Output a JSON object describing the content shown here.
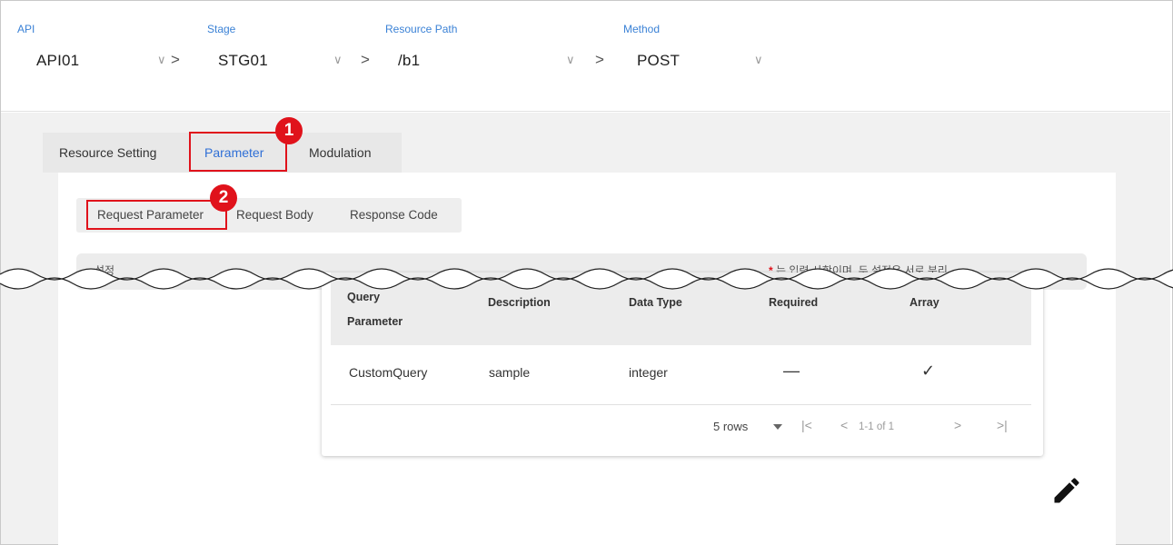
{
  "breadcrumb": {
    "api": {
      "label": "API",
      "value": "API01"
    },
    "stage": {
      "label": "Stage",
      "value": "STG01"
    },
    "resource_path": {
      "label": "Resource Path",
      "value": "/b1"
    },
    "method": {
      "label": "Method",
      "value": "POST"
    },
    "separator": ">",
    "chevron": "∨"
  },
  "tabs": [
    {
      "label": "Resource Setting"
    },
    {
      "label": "Parameter",
      "active": true
    },
    {
      "label": "Modulation"
    }
  ],
  "subtabs": [
    {
      "label": "Request Parameter",
      "active": true
    },
    {
      "label": "Request Body"
    },
    {
      "label": "Response Code"
    }
  ],
  "callouts": [
    "1",
    "2"
  ],
  "notice": {
    "left": "설정",
    "star": "*",
    "right": "는 입력 사항이며, 두 설정은 서로 분리"
  },
  "table": {
    "columns": [
      "Query Parameter",
      "Description",
      "Data Type",
      "Required",
      "Array"
    ],
    "rows": [
      {
        "query": "CustomQuery",
        "description": "sample",
        "data_type": "integer",
        "required": "—",
        "array": "✓"
      }
    ],
    "footer": {
      "rows_per_page": "5 rows",
      "range": "1-1 of 1",
      "first": "|<",
      "prev": "<",
      "next": ">",
      "last": ">|"
    }
  },
  "colors": {
    "accent": "#2f6fd6",
    "label_blue": "#3b82d6",
    "callout_red": "#e0121b"
  },
  "icons": [
    "chevron-down-icon",
    "pencil-icon",
    "dropdown-caret-icon",
    "check-icon"
  ]
}
